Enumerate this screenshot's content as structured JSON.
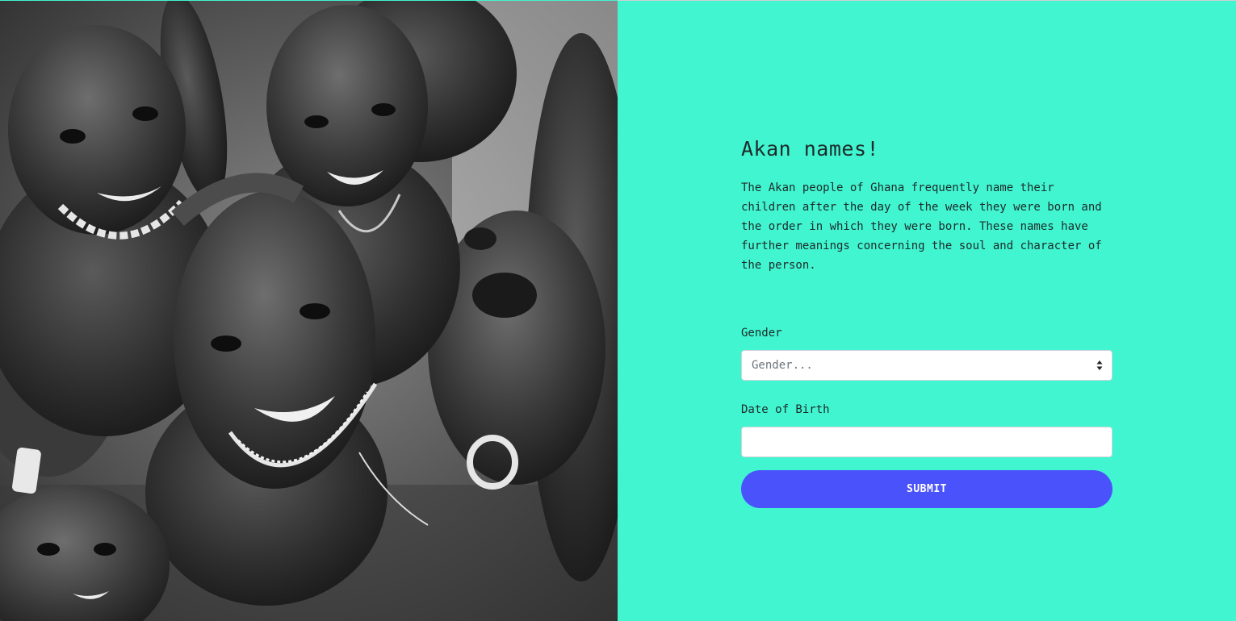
{
  "hero_image": {
    "icon": "children-photo-image"
  },
  "colors": {
    "panel_bg": "#40f5d0",
    "button_bg": "#4a52fb",
    "button_text": "#ffffff",
    "text": "#1f2a2a"
  },
  "intro": {
    "title": "Akan names!",
    "description": "The Akan people of Ghana frequently name their children after the day of the week they were born and the order in which they were born. These names have further meanings concerning the soul and character of the person."
  },
  "form": {
    "gender_label": "Gender",
    "gender_selected": "Gender...",
    "dob_label": "Date of Birth",
    "dob_value": "",
    "submit_label": "SUBMIT"
  }
}
